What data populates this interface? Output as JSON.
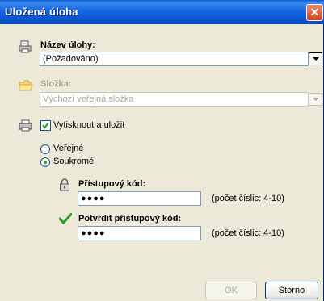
{
  "window": {
    "title": "Uložená úloha",
    "close_glyph": "✕"
  },
  "job_name": {
    "label": "Název úlohy:",
    "value": "(Požadováno)"
  },
  "folder": {
    "label": "Složka:",
    "value": "Výchozí veřejná složka"
  },
  "print_and_save": {
    "label": "Vytisknout a uložit",
    "checked": true
  },
  "visibility": {
    "public_label": "Veřejné",
    "private_label": "Soukromé",
    "selected": "private"
  },
  "access_code": {
    "label": "Přístupový kód:",
    "value": "●●●●",
    "hint": "(počet číslic: 4-10)"
  },
  "confirm_code": {
    "label": "Potvrdit přístupový kód:",
    "value": "●●●●",
    "hint": "(počet číslic: 4-10)"
  },
  "buttons": {
    "ok": "OK",
    "cancel": "Storno"
  },
  "icons": {
    "job": "printer-document-icon",
    "folder": "folder-icon",
    "printer": "printer-icon",
    "lock": "lock-icon",
    "check": "checkmark-icon"
  }
}
